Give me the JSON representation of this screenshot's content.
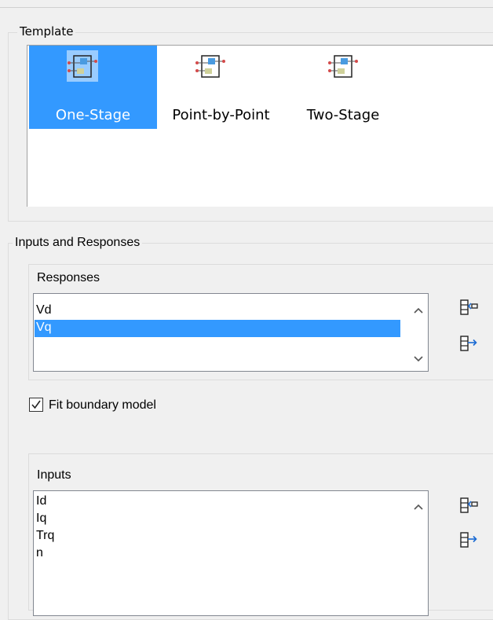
{
  "template_group": {
    "title": "Template",
    "items": [
      {
        "label": "One-Stage",
        "icon": "one-stage-model-icon",
        "selected": true
      },
      {
        "label": "Point-by-Point",
        "icon": "point-by-point-model-icon",
        "selected": false
      },
      {
        "label": "Two-Stage",
        "icon": "two-stage-model-icon",
        "selected": false
      }
    ]
  },
  "inputs_responses_group": {
    "title": "Inputs and Responses",
    "responses": {
      "title": "Responses",
      "items": [
        "Vd",
        "Vq"
      ],
      "selected": "Vq",
      "add_icon": "add-response-icon",
      "remove_icon": "remove-response-icon"
    },
    "fit_boundary": {
      "label": "Fit boundary model",
      "checked": true
    },
    "inputs": {
      "title": "Inputs",
      "items": [
        "Id",
        "Iq",
        "Trq",
        "n"
      ],
      "add_icon": "add-input-icon",
      "remove_icon": "remove-input-icon"
    }
  },
  "colors": {
    "selection": "#3399ff",
    "background": "#f0f0f0"
  }
}
